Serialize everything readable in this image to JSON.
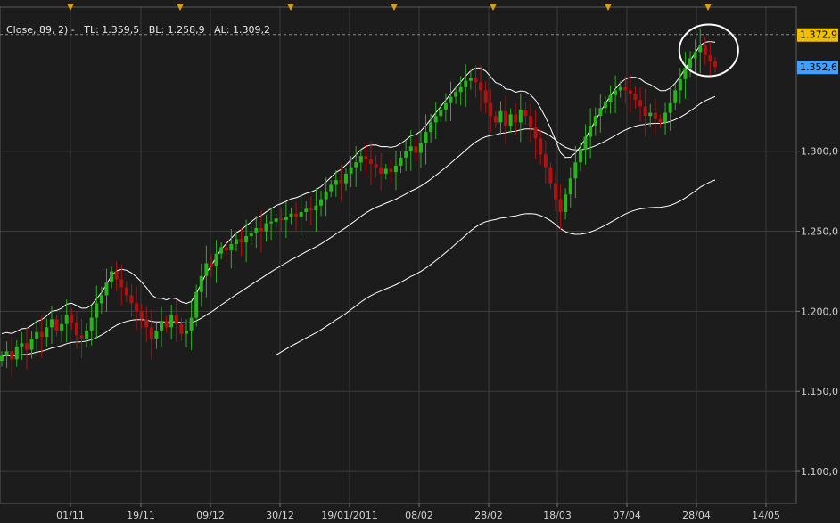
{
  "legend": {
    "head": "Close, 89, 2) -",
    "tl": "TL: 1.359,5",
    "bl": "BL: 1.258,9",
    "al": "AL: 1.309,2"
  },
  "colors": {
    "background": "#1c1c1c",
    "grid": "#3c3c3c",
    "axis_text": "#d0d0d0",
    "bull": "#28b41c",
    "bear": "#b41010",
    "band": "#ffffff",
    "marker": "#d4a020",
    "tag_last_high": "#f0c000",
    "tag_last_price": "#40a0ff"
  },
  "chart_data": {
    "type": "candlestick",
    "y_range": [
      1080,
      1390
    ],
    "y_ticks": [
      1100,
      1150,
      1200,
      1250,
      1300
    ],
    "y_tick_labels": [
      "1.100,0",
      "1.150,0",
      "1.200,0",
      "1.250,0",
      "1.300,0"
    ],
    "x_tick_labels": [
      "01/11",
      "19/11",
      "09/12",
      "30/12",
      "19/01/2011",
      "08/02",
      "28/02",
      "18/03",
      "07/04",
      "28/04",
      "14/05"
    ],
    "price_tags": [
      {
        "label": "1.372,9",
        "value": 1372.9,
        "style": "last_high"
      },
      {
        "label": "1.352,6",
        "value": 1352.6,
        "style": "last_price"
      }
    ],
    "reference_line": 1372.9,
    "event_markers": 8,
    "highlight": "circle around latest candles",
    "candles_close": [
      1172,
      1175,
      1170,
      1178,
      1180,
      1176,
      1183,
      1187,
      1184,
      1190,
      1195,
      1188,
      1192,
      1198,
      1193,
      1185,
      1183,
      1188,
      1196,
      1205,
      1210,
      1218,
      1225,
      1220,
      1215,
      1210,
      1205,
      1200,
      1195,
      1190,
      1183,
      1188,
      1194,
      1190,
      1198,
      1192,
      1186,
      1188,
      1196,
      1212,
      1222,
      1230,
      1228,
      1236,
      1240,
      1238,
      1242,
      1245,
      1243,
      1247,
      1249,
      1252,
      1250,
      1255,
      1256,
      1258,
      1257,
      1259,
      1261,
      1259,
      1262,
      1264,
      1263,
      1266,
      1270,
      1275,
      1279,
      1282,
      1280,
      1286,
      1290,
      1293,
      1297,
      1295,
      1292,
      1290,
      1286,
      1289,
      1287,
      1291,
      1296,
      1300,
      1303,
      1299,
      1305,
      1312,
      1318,
      1322,
      1326,
      1330,
      1334,
      1337,
      1340,
      1344,
      1346,
      1343,
      1338,
      1330,
      1322,
      1318,
      1325,
      1316,
      1323,
      1318,
      1326,
      1322,
      1315,
      1308,
      1298,
      1290,
      1280,
      1270,
      1262,
      1273,
      1283,
      1293,
      1301,
      1309,
      1316,
      1322,
      1327,
      1331,
      1335,
      1338,
      1340,
      1338,
      1336,
      1332,
      1328,
      1322,
      1324,
      1320,
      1318,
      1324,
      1330,
      1338,
      1345,
      1352,
      1358,
      1362,
      1366,
      1360,
      1356,
      1352.6
    ]
  }
}
